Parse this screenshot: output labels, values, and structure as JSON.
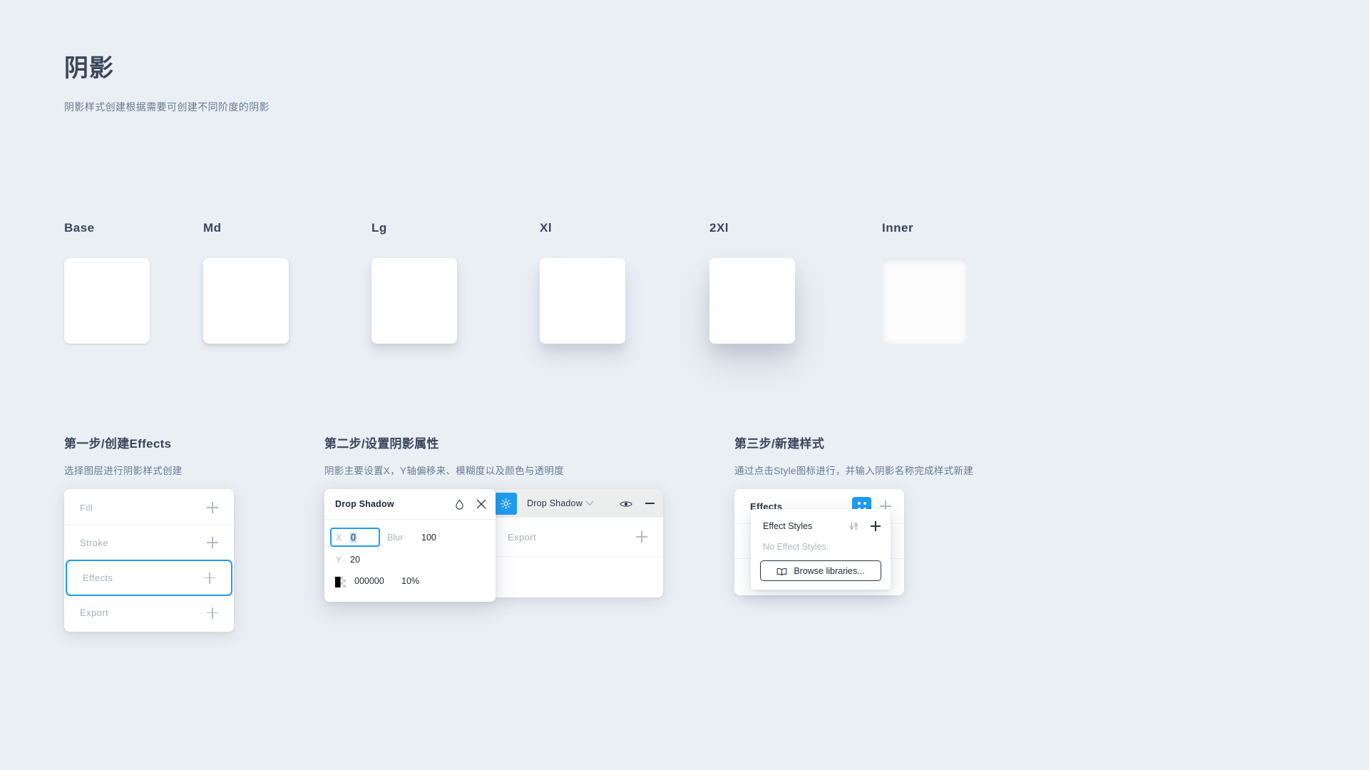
{
  "header": {
    "title": "阴影",
    "subtitle": "阴影样式创建根据需要可创建不同阶度的阴影"
  },
  "swatches": [
    {
      "label": "Base"
    },
    {
      "label": "Md"
    },
    {
      "label": "Lg"
    },
    {
      "label": "Xl"
    },
    {
      "label": "2Xl"
    },
    {
      "label": "Inner"
    }
  ],
  "steps": [
    {
      "title": "第一步/创建Effects",
      "desc": "选择图层进行阴影样式创建"
    },
    {
      "title": "第二步/设置阴影属性",
      "desc": "阴影主要设置X，Y轴偏移来、模糊度以及颜色与透明度"
    },
    {
      "title": "第三步/新建样式",
      "desc": "通过点击Style图标进行，并输入阴影名称完成样式新建"
    }
  ],
  "properties_panel": {
    "rows": [
      {
        "label": "Fill",
        "selected": false
      },
      {
        "label": "Stroke",
        "selected": false
      },
      {
        "label": "Effects",
        "selected": true
      },
      {
        "label": "Export",
        "selected": false
      }
    ]
  },
  "effects_panel": {
    "effect_name": "Drop Shadow",
    "export_label": "Export"
  },
  "drop_shadow_popup": {
    "title": "Drop Shadow",
    "x_key": "X",
    "x_value": "0",
    "y_key": "Y",
    "y_value": "20",
    "blur_key": "Blur",
    "blur_value": "100",
    "color_hex": "000000",
    "color_opacity": "10%"
  },
  "styles_panel": {
    "title": "Effects",
    "dropdown": {
      "title": "Effect Styles",
      "empty_text": "No Effect Styles.",
      "browse_label": "Browse libraries..."
    },
    "hidden_rows": [
      {
        "label": ""
      },
      {
        "label": ""
      }
    ]
  },
  "colors": {
    "accent": "#1f9cf0",
    "background": "#eaeff4",
    "card": "#ffffff",
    "text_dark": "#39455a",
    "text_muted": "#6b7a90",
    "text_placeholder": "#a8aeb8"
  }
}
